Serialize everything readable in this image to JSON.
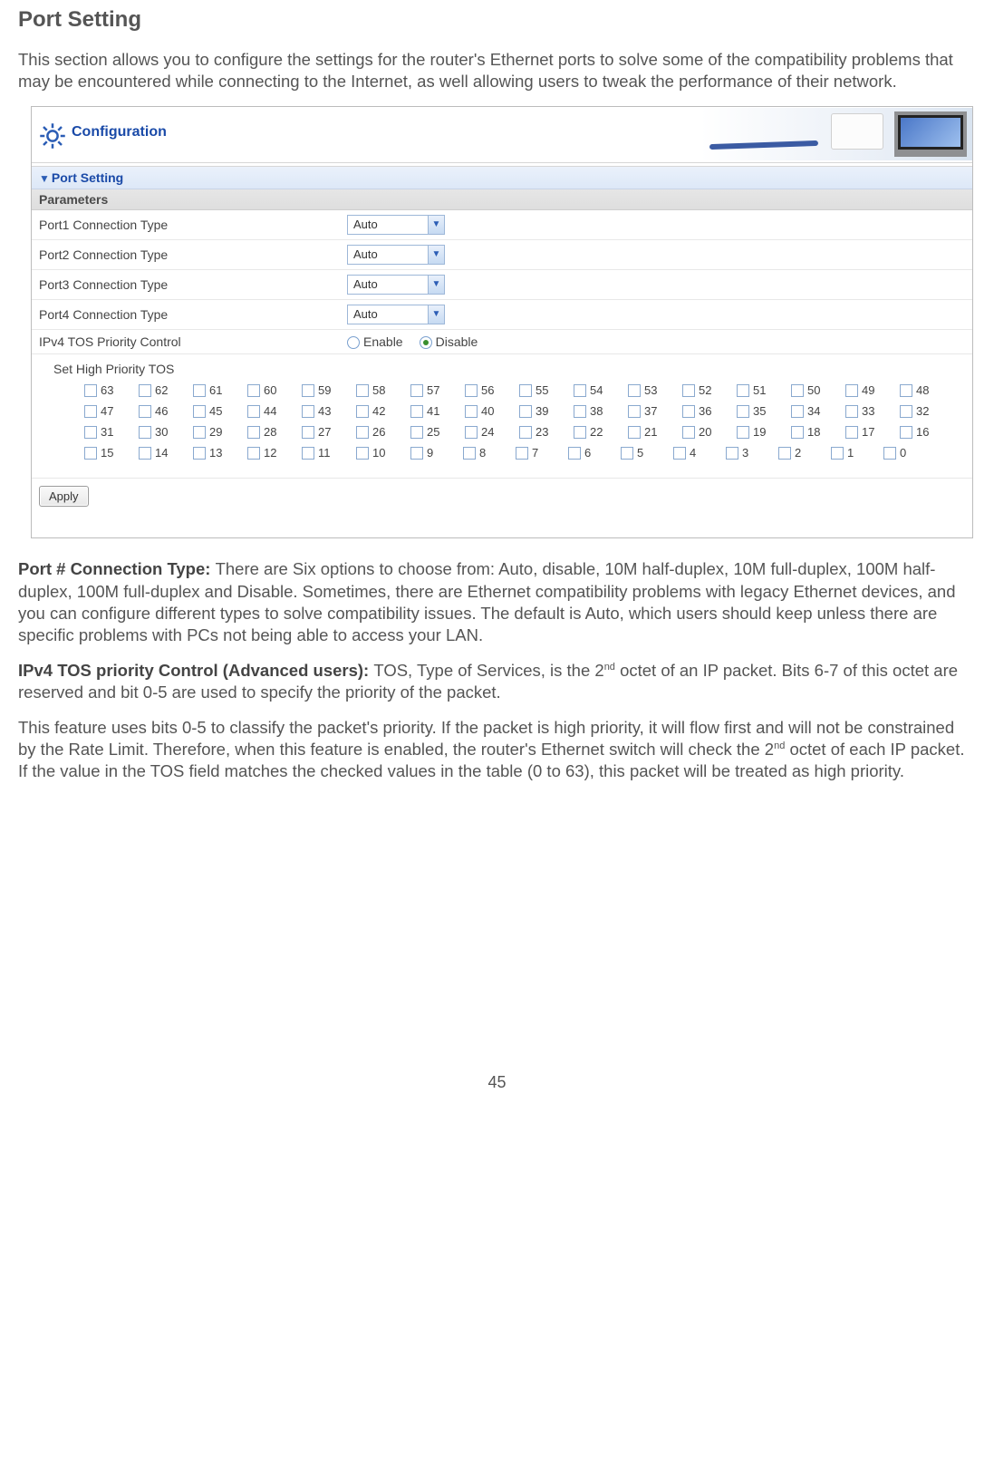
{
  "page": {
    "title": "Port Setting",
    "intro": "This section allows you to configure the settings for the router's Ethernet ports to solve some of the compatibility problems that may be encountered while connecting to the Internet, as well allowing users to tweak the performance of their network.",
    "page_number": "45"
  },
  "shot": {
    "config_header": "Configuration",
    "section_title": "Port Setting",
    "parameters_label": "Parameters",
    "rows": {
      "port1_label": "Port1  Connection Type",
      "port2_label": "Port2  Connection Type",
      "port3_label": "Port3  Connection Type",
      "port4_label": "Port4  Connection Type",
      "tos_label": "IPv4 TOS Priority Control",
      "select_value": "Auto",
      "enable": "Enable",
      "disable": "Disable"
    },
    "tos_title": "Set High Priority TOS",
    "tos_rows": [
      [
        "63",
        "62",
        "61",
        "60",
        "59",
        "58",
        "57",
        "56",
        "55",
        "54",
        "53",
        "52",
        "51",
        "50",
        "49",
        "48"
      ],
      [
        "47",
        "46",
        "45",
        "44",
        "43",
        "42",
        "41",
        "40",
        "39",
        "38",
        "37",
        "36",
        "35",
        "34",
        "33",
        "32"
      ],
      [
        "31",
        "30",
        "29",
        "28",
        "27",
        "26",
        "25",
        "24",
        "23",
        "22",
        "21",
        "20",
        "19",
        "18",
        "17",
        "16"
      ],
      [
        "15",
        "14",
        "13",
        "12",
        "11",
        "10",
        "9",
        "8",
        "7",
        "6",
        "5",
        "4",
        "3",
        "2",
        "1",
        "0"
      ]
    ],
    "apply": "Apply"
  },
  "explain": {
    "p1_bold": "Port # Connection Type: ",
    "p1_text": "There are Six options to choose from: Auto, disable, 10M half-duplex, 10M full-duplex, 100M half-duplex, 100M full-duplex and Disable. Sometimes, there are Ethernet compatibility problems with legacy Ethernet devices, and you can configure different types to solve compatibility issues. The default is Auto, which users should keep unless there are specific problems with PCs not being able to access your LAN.",
    "p2_bold": "IPv4 TOS priority Control (Advanced users): ",
    "p2_text_a": "TOS, Type of Services, is the 2",
    "p2_sup": "nd",
    "p2_text_b": " octet of an IP packet. Bits 6-7 of this octet are reserved and bit 0-5 are used to specify the priority of the packet.",
    "p3_text_a": "This feature uses bits 0-5 to classify the packet's priority. If the packet is high priority, it will flow first and will not be constrained by the Rate Limit.  Therefore, when this feature is enabled, the router's Ethernet switch will check the 2",
    "p3_sup": "nd",
    "p3_text_b": " octet of each IP packet. If the value in the TOS field matches the checked values in the table (0 to 63), this packet will be treated as high priority."
  }
}
